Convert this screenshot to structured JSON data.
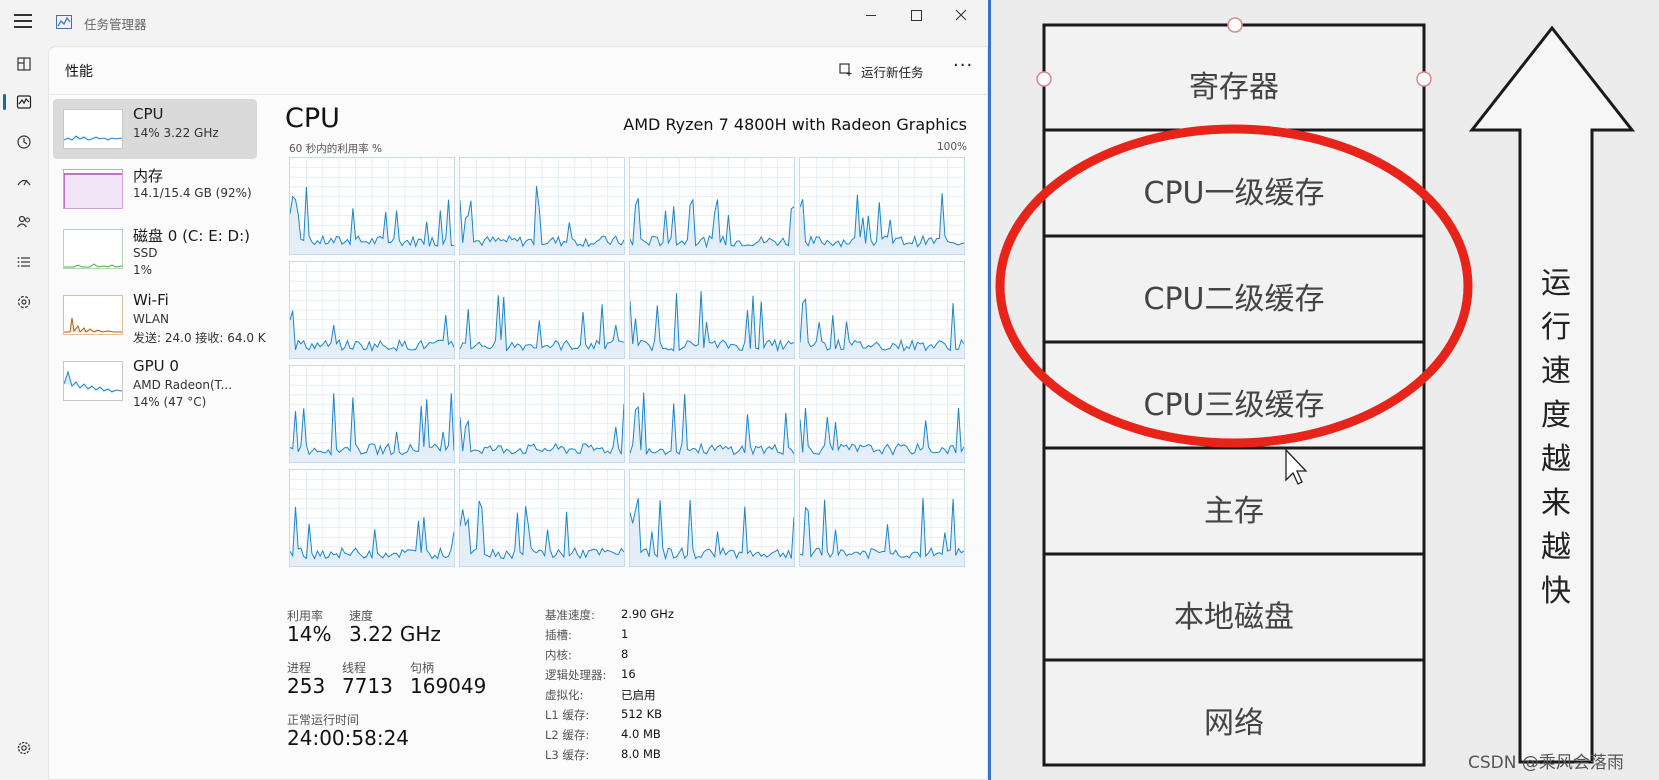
{
  "window": {
    "title": "任务管理器"
  },
  "rail": {
    "items": [
      "menu",
      "processes",
      "performance",
      "history",
      "startup",
      "users",
      "details",
      "services",
      "settings"
    ]
  },
  "header": {
    "title": "性能",
    "run_task_label": "运行新任务"
  },
  "devices": [
    {
      "name": "CPU",
      "sub1": "14%  3.22 GHz",
      "sub2": ""
    },
    {
      "name": "内存",
      "sub1": "14.1/15.4 GB (92%)",
      "sub2": ""
    },
    {
      "name": "磁盘 0 (C: E: D:)",
      "sub1": "SSD",
      "sub2": "1%"
    },
    {
      "name": "Wi-Fi",
      "sub1": "WLAN",
      "sub2": "发送: 24.0  接收: 64.0 K"
    },
    {
      "name": "GPU 0",
      "sub1": "AMD Radeon(T...",
      "sub2": "14% (47 °C)"
    }
  ],
  "cpu": {
    "title": "CPU",
    "model": "AMD Ryzen 7 4800H with Radeon Graphics",
    "graph_label": "60 秒内的利用率 %",
    "graph_max": "100%",
    "util_label": "利用率",
    "util": "14%",
    "speed_label": "速度",
    "speed": "3.22 GHz",
    "proc_label": "进程",
    "proc": "253",
    "thread_label": "线程",
    "thread": "7713",
    "handle_label": "句柄",
    "handle": "169049",
    "uptime_label": "正常运行时间",
    "uptime": "24:00:58:24",
    "specs": [
      {
        "k": "基准速度:",
        "v": "2.90 GHz"
      },
      {
        "k": "插槽:",
        "v": "1"
      },
      {
        "k": "内核:",
        "v": "8"
      },
      {
        "k": "逻辑处理器:",
        "v": "16"
      },
      {
        "k": "虚拟化:",
        "v": "已启用"
      },
      {
        "k": "L1 缓存:",
        "v": "512 KB"
      },
      {
        "k": "L2 缓存:",
        "v": "4.0 MB"
      },
      {
        "k": "L3 缓存:",
        "v": "8.0 MB"
      }
    ]
  },
  "diagram": {
    "levels": [
      "寄存器",
      "CPU一级缓存",
      "CPU二级缓存",
      "CPU三级缓存",
      "主存",
      "本地磁盘",
      "网络"
    ],
    "arrow_label": "运行速度越来越快",
    "highlight_color": "#e8231a",
    "watermark": "CSDN @乘风会落雨"
  },
  "colors": {
    "accent": "#0f6cbd",
    "cpu_line": "#1a86c8",
    "mem_line": "#9b2fae",
    "disk_line": "#4aa84a",
    "net_line": "#b85c0a"
  }
}
